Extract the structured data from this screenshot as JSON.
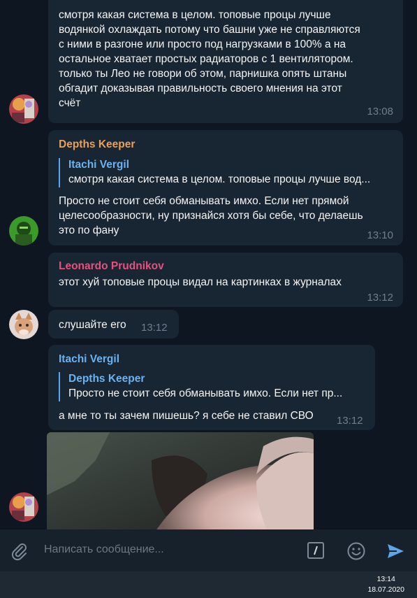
{
  "messages": {
    "m1": {
      "lines": [
        "смотря какая система в целом. топовые процы лучше",
        "водянкой охлаждать потому что башни уже не справляются",
        "с ними в разгоне или просто под нагрузками в 100% а на",
        "остальное хватает простых радиаторов с 1 вентилятором.",
        "только ты Лео не говори об этом, парнишка опять штаны",
        "обгадит доказывая правильность своего мнения на этот",
        "счёт"
      ],
      "time": "13:08"
    },
    "m2": {
      "sender": "Depths Keeper",
      "reply_name": "Itachi Vergil",
      "reply_text": "смотря какая система в целом. топовые процы лучше вод...",
      "lines": [
        "Просто не стоит себя обманывать имхо. Если нет прямой",
        "целесообразности, ну признайся хотя бы себе, что делаешь",
        "это по фану"
      ],
      "time": "13:10"
    },
    "m3": {
      "sender": "Leonardo Prudnikov",
      "text": "этот хуй топовые процы видал на картинках в журналах",
      "time": "13:12"
    },
    "m4": {
      "text": "слушайте его",
      "time": "13:12"
    },
    "m5": {
      "sender": "Itachi Vergil",
      "reply_name": "Depths Keeper",
      "reply_text": "Просто не стоит себя обманывать имхо. Если нет пр...",
      "text": "а мне то ты зачем пишешь? я себе не ставил СВО",
      "time": "13:12"
    }
  },
  "composer": {
    "placeholder": "Написать сообщение..."
  },
  "taskbar": {
    "time": "13:14",
    "date": "18.07.2020"
  },
  "colors": {
    "background": "#0e1621",
    "bubble": "#182533",
    "sender_orange": "#e8a15a",
    "sender_pink": "#e6527c",
    "sender_blue": "#6ab3f3",
    "accent": "#5ea5e8"
  }
}
